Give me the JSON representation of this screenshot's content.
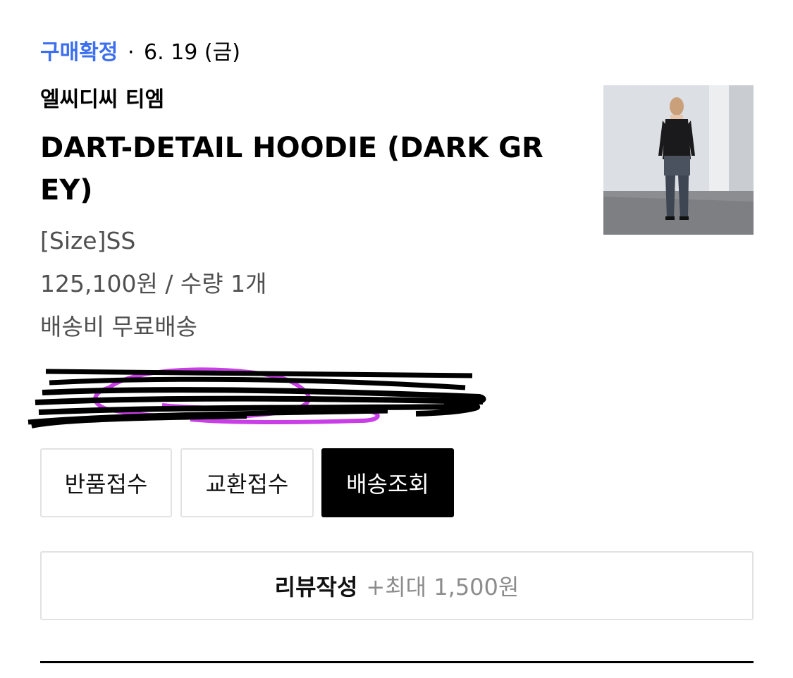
{
  "order": {
    "status_label": "구매확정",
    "separator": "·",
    "date": "6. 19 (금)"
  },
  "product": {
    "brand": "엘씨디씨 티엠",
    "name": "DART-DETAIL HOODIE (DARK GREY)",
    "option": "[Size]SS",
    "price_quantity": "125,100원 / 수량 1개",
    "shipping": "배송비 무료배송"
  },
  "actions": {
    "return_label": "반품접수",
    "exchange_label": "교환접수",
    "tracking_label": "배송조회"
  },
  "review": {
    "label": "리뷰작성",
    "reward": "+최대 1,500원"
  },
  "colors": {
    "status_accent": "#3b6ef0",
    "scribble_black": "#000000",
    "scribble_purple": "#c93ee6"
  }
}
